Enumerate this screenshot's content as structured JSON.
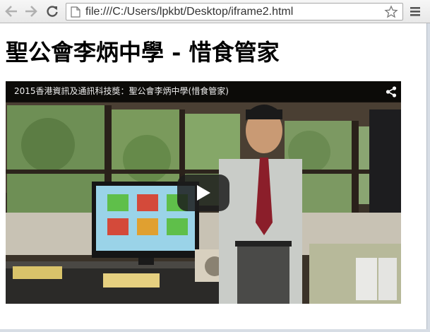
{
  "browser": {
    "url": "file:///C:/Users/lpkbt/Desktop/iframe2.html",
    "icons": {
      "back": "back-arrow-icon",
      "forward": "forward-arrow-icon",
      "reload": "reload-icon",
      "page": "page-icon",
      "bookmark": "star-icon",
      "menu": "menu-icon"
    }
  },
  "page": {
    "title": "聖公會李炳中學 - 惜食管家"
  },
  "video": {
    "title": "2015香港資訊及通訊科技獎：聖公會李炳中學(惜食管家)",
    "icons": {
      "share": "share-icon",
      "play": "play-icon"
    },
    "colors": {
      "topbar": "#000000",
      "play_button": "#1c1c1c"
    }
  }
}
